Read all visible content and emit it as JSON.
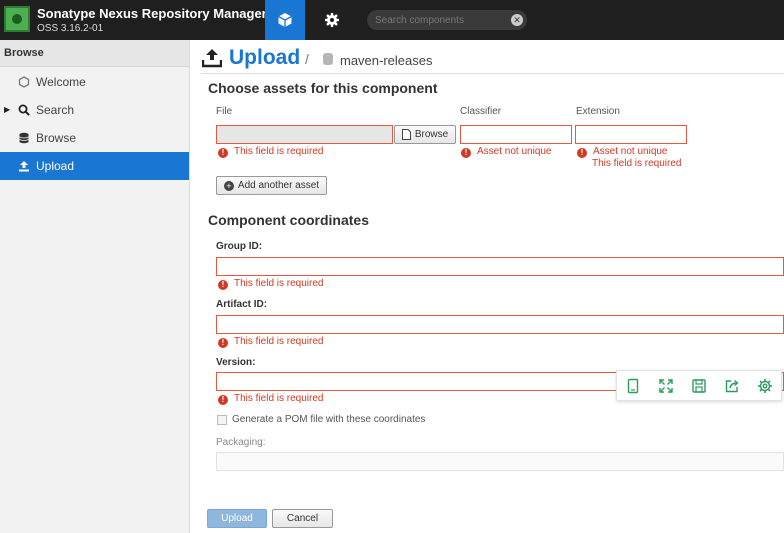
{
  "app": {
    "title": "Sonatype Nexus Repository Manager",
    "version": "OSS 3.16.2-01"
  },
  "header": {
    "search_placeholder": "Search components",
    "buttons": [
      {
        "name": "browse-cube-button",
        "icon": "cube-icon",
        "active": true
      },
      {
        "name": "admin-gear-button",
        "icon": "gear-icon",
        "active": false
      }
    ]
  },
  "sidebar": {
    "header": "Browse",
    "items": [
      {
        "label": "Welcome",
        "icon": "hexagon-icon"
      },
      {
        "label": "Search",
        "icon": "search-icon",
        "expandable": true
      },
      {
        "label": "Browse",
        "icon": "database-icon"
      },
      {
        "label": "Upload",
        "icon": "upload-icon",
        "active": true
      }
    ]
  },
  "breadcrumb": {
    "title": "Upload",
    "separator": "/",
    "repository": "maven-releases"
  },
  "assets": {
    "section_title": "Choose assets for this component",
    "col_file": "File",
    "col_classifier": "Classifier",
    "col_extension": "Extension",
    "browse_label": "Browse",
    "file_error": "This field is required",
    "classifier_error": "Asset not unique",
    "extension_error_1": "Asset not unique",
    "extension_error_2": "This field is required",
    "add_asset_label": "Add another asset"
  },
  "coordinates": {
    "section_title": "Component coordinates",
    "group_label": "Group ID:",
    "group_error": "This field is required",
    "artifact_label": "Artifact ID:",
    "artifact_error": "This field is required",
    "version_label": "Version:",
    "version_error": "This field is required",
    "pom_label": "Generate a POM file with these coordinates",
    "packaging_label": "Packaging:"
  },
  "footer": {
    "upload_label": "Upload",
    "cancel_label": "Cancel"
  },
  "toolbar_overlay": {
    "icons": [
      "tablet-icon",
      "expand-icon",
      "save-icon",
      "share-icon",
      "settings-icon"
    ]
  },
  "colors": {
    "accent": "#1976d2",
    "error": "#cf3a24",
    "topbar": "#1f1f1f",
    "overlay_icon": "#2e9b5e"
  }
}
